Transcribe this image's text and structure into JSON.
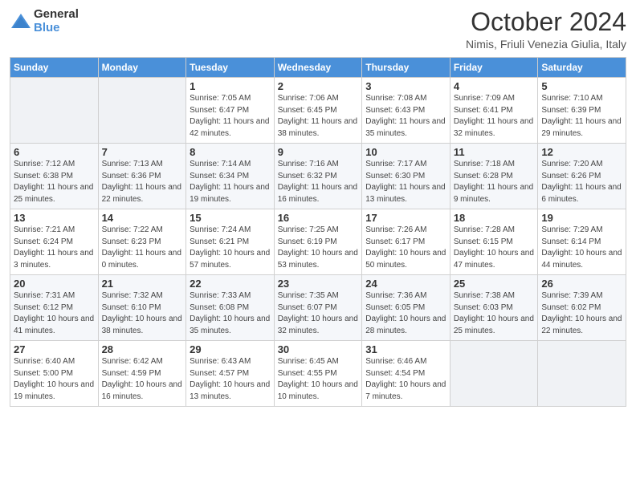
{
  "header": {
    "logo_general": "General",
    "logo_blue": "Blue",
    "month_title": "October 2024",
    "subtitle": "Nimis, Friuli Venezia Giulia, Italy"
  },
  "weekdays": [
    "Sunday",
    "Monday",
    "Tuesday",
    "Wednesday",
    "Thursday",
    "Friday",
    "Saturday"
  ],
  "weeks": [
    [
      {
        "day": "",
        "info": ""
      },
      {
        "day": "",
        "info": ""
      },
      {
        "day": "1",
        "info": "Sunrise: 7:05 AM\nSunset: 6:47 PM\nDaylight: 11 hours and 42 minutes."
      },
      {
        "day": "2",
        "info": "Sunrise: 7:06 AM\nSunset: 6:45 PM\nDaylight: 11 hours and 38 minutes."
      },
      {
        "day": "3",
        "info": "Sunrise: 7:08 AM\nSunset: 6:43 PM\nDaylight: 11 hours and 35 minutes."
      },
      {
        "day": "4",
        "info": "Sunrise: 7:09 AM\nSunset: 6:41 PM\nDaylight: 11 hours and 32 minutes."
      },
      {
        "day": "5",
        "info": "Sunrise: 7:10 AM\nSunset: 6:39 PM\nDaylight: 11 hours and 29 minutes."
      }
    ],
    [
      {
        "day": "6",
        "info": "Sunrise: 7:12 AM\nSunset: 6:38 PM\nDaylight: 11 hours and 25 minutes."
      },
      {
        "day": "7",
        "info": "Sunrise: 7:13 AM\nSunset: 6:36 PM\nDaylight: 11 hours and 22 minutes."
      },
      {
        "day": "8",
        "info": "Sunrise: 7:14 AM\nSunset: 6:34 PM\nDaylight: 11 hours and 19 minutes."
      },
      {
        "day": "9",
        "info": "Sunrise: 7:16 AM\nSunset: 6:32 PM\nDaylight: 11 hours and 16 minutes."
      },
      {
        "day": "10",
        "info": "Sunrise: 7:17 AM\nSunset: 6:30 PM\nDaylight: 11 hours and 13 minutes."
      },
      {
        "day": "11",
        "info": "Sunrise: 7:18 AM\nSunset: 6:28 PM\nDaylight: 11 hours and 9 minutes."
      },
      {
        "day": "12",
        "info": "Sunrise: 7:20 AM\nSunset: 6:26 PM\nDaylight: 11 hours and 6 minutes."
      }
    ],
    [
      {
        "day": "13",
        "info": "Sunrise: 7:21 AM\nSunset: 6:24 PM\nDaylight: 11 hours and 3 minutes."
      },
      {
        "day": "14",
        "info": "Sunrise: 7:22 AM\nSunset: 6:23 PM\nDaylight: 11 hours and 0 minutes."
      },
      {
        "day": "15",
        "info": "Sunrise: 7:24 AM\nSunset: 6:21 PM\nDaylight: 10 hours and 57 minutes."
      },
      {
        "day": "16",
        "info": "Sunrise: 7:25 AM\nSunset: 6:19 PM\nDaylight: 10 hours and 53 minutes."
      },
      {
        "day": "17",
        "info": "Sunrise: 7:26 AM\nSunset: 6:17 PM\nDaylight: 10 hours and 50 minutes."
      },
      {
        "day": "18",
        "info": "Sunrise: 7:28 AM\nSunset: 6:15 PM\nDaylight: 10 hours and 47 minutes."
      },
      {
        "day": "19",
        "info": "Sunrise: 7:29 AM\nSunset: 6:14 PM\nDaylight: 10 hours and 44 minutes."
      }
    ],
    [
      {
        "day": "20",
        "info": "Sunrise: 7:31 AM\nSunset: 6:12 PM\nDaylight: 10 hours and 41 minutes."
      },
      {
        "day": "21",
        "info": "Sunrise: 7:32 AM\nSunset: 6:10 PM\nDaylight: 10 hours and 38 minutes."
      },
      {
        "day": "22",
        "info": "Sunrise: 7:33 AM\nSunset: 6:08 PM\nDaylight: 10 hours and 35 minutes."
      },
      {
        "day": "23",
        "info": "Sunrise: 7:35 AM\nSunset: 6:07 PM\nDaylight: 10 hours and 32 minutes."
      },
      {
        "day": "24",
        "info": "Sunrise: 7:36 AM\nSunset: 6:05 PM\nDaylight: 10 hours and 28 minutes."
      },
      {
        "day": "25",
        "info": "Sunrise: 7:38 AM\nSunset: 6:03 PM\nDaylight: 10 hours and 25 minutes."
      },
      {
        "day": "26",
        "info": "Sunrise: 7:39 AM\nSunset: 6:02 PM\nDaylight: 10 hours and 22 minutes."
      }
    ],
    [
      {
        "day": "27",
        "info": "Sunrise: 6:40 AM\nSunset: 5:00 PM\nDaylight: 10 hours and 19 minutes."
      },
      {
        "day": "28",
        "info": "Sunrise: 6:42 AM\nSunset: 4:59 PM\nDaylight: 10 hours and 16 minutes."
      },
      {
        "day": "29",
        "info": "Sunrise: 6:43 AM\nSunset: 4:57 PM\nDaylight: 10 hours and 13 minutes."
      },
      {
        "day": "30",
        "info": "Sunrise: 6:45 AM\nSunset: 4:55 PM\nDaylight: 10 hours and 10 minutes."
      },
      {
        "day": "31",
        "info": "Sunrise: 6:46 AM\nSunset: 4:54 PM\nDaylight: 10 hours and 7 minutes."
      },
      {
        "day": "",
        "info": ""
      },
      {
        "day": "",
        "info": ""
      }
    ]
  ]
}
